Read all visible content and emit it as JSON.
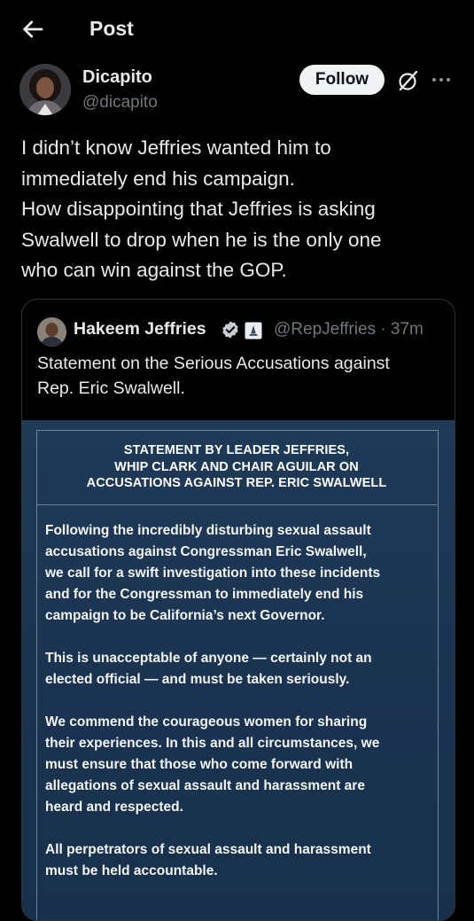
{
  "header": {
    "title": "Post",
    "back_icon": "back-arrow-icon"
  },
  "author": {
    "name": "Dicapito",
    "handle": "@dicapito",
    "follow_label": "Follow"
  },
  "post": {
    "lines": [
      "I didn’t know Jeffries wanted him to",
      "immediately end his campaign.",
      "How disappointing that Jeffries is asking",
      "Swalwell to drop when he is the only one",
      "who can win against the GOP."
    ]
  },
  "quote": {
    "name": "Hakeem Jeffries",
    "handle_time": "@RepJeffries · 37m",
    "text_lines": [
      "Statement on the Serious Accusations against",
      "Rep. Eric Swalwell."
    ],
    "statement": {
      "heading_lines": [
        "STATEMENT BY LEADER JEFFRIES,",
        "WHIP CLARK AND CHAIR AGUILAR ON",
        "ACCUSATIONS AGAINST REP. ERIC SWALWELL"
      ],
      "paragraphs": [
        [
          "Following the incredibly disturbing sexual assault",
          "accusations against Congressman Eric Swalwell,",
          "we call for a swift investigation into these incidents",
          "and for the Congressman to immediately end his",
          "campaign to be California’s next Governor."
        ],
        [
          "This is unacceptable of anyone — certainly not an",
          "elected official — and must be taken seriously."
        ],
        [
          "We commend the courageous women for sharing",
          "their experiences. In this and all circumstances, we",
          "must ensure that those who come forward with",
          "allegations of sexual assault and harassment are",
          "heard and respected."
        ],
        [
          "All perpetrators of sexual assault and harassment",
          "must be held accountable."
        ]
      ]
    }
  },
  "colors": {
    "background": "#000000",
    "text": "#e7e9ea",
    "muted": "#71767b",
    "verified": "#1d9bf0",
    "statement_bg": "#1d3652"
  }
}
